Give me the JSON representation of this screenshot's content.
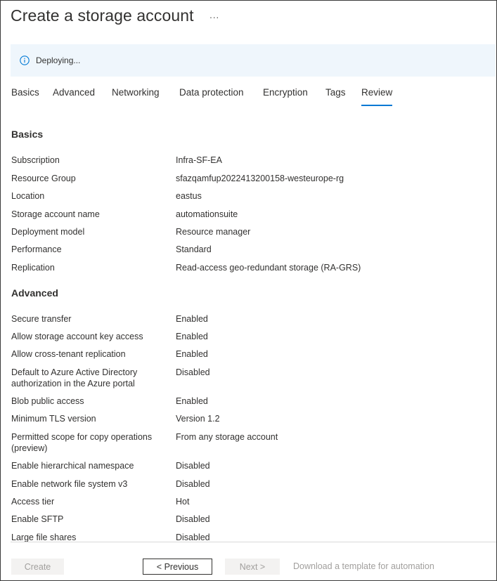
{
  "header": {
    "title": "Create a storage account",
    "more_label": "···"
  },
  "banner": {
    "icon": "info-icon",
    "text": "Deploying..."
  },
  "tabs": [
    "Basics",
    "Advanced",
    "Networking",
    "Data protection",
    "Encryption",
    "Tags",
    "Review"
  ],
  "active_tab": "Review",
  "sections": {
    "basics": {
      "title": "Basics",
      "rows": [
        {
          "label": "Subscription",
          "value": "Infra-SF-EA"
        },
        {
          "label": "Resource Group",
          "value": "sfazqamfup2022413200158-westeurope-rg"
        },
        {
          "label": "Location",
          "value": "eastus"
        },
        {
          "label": "Storage account name",
          "value": "automationsuite"
        },
        {
          "label": "Deployment model",
          "value": "Resource manager"
        },
        {
          "label": "Performance",
          "value": "Standard"
        },
        {
          "label": "Replication",
          "value": "Read-access geo-redundant storage (RA-GRS)"
        }
      ]
    },
    "advanced": {
      "title": "Advanced",
      "rows": [
        {
          "label": "Secure transfer",
          "value": "Enabled"
        },
        {
          "label": "Allow storage account key access",
          "value": "Enabled"
        },
        {
          "label": "Allow cross-tenant replication",
          "value": "Enabled"
        },
        {
          "label": "Default to Azure Active Directory authorization in the Azure portal",
          "value": "Disabled"
        },
        {
          "label": "Blob public access",
          "value": "Enabled"
        },
        {
          "label": "Minimum TLS version",
          "value": "Version 1.2"
        },
        {
          "label": "Permitted scope for copy operations (preview)",
          "value": "From any storage account"
        },
        {
          "label": "Enable hierarchical namespace",
          "value": "Disabled"
        },
        {
          "label": "Enable network file system v3",
          "value": "Disabled"
        },
        {
          "label": "Access tier",
          "value": "Hot"
        },
        {
          "label": "Enable SFTP",
          "value": "Disabled"
        },
        {
          "label": "Large file shares",
          "value": "Disabled"
        }
      ]
    }
  },
  "footer": {
    "create_label": "Create",
    "previous_label": "< Previous",
    "next_label": "Next >",
    "download_label": "Download a template for automation"
  },
  "colors": {
    "accent": "#0078d4",
    "banner_bg": "#eff6fc",
    "disabled_text": "#a19f9d"
  }
}
